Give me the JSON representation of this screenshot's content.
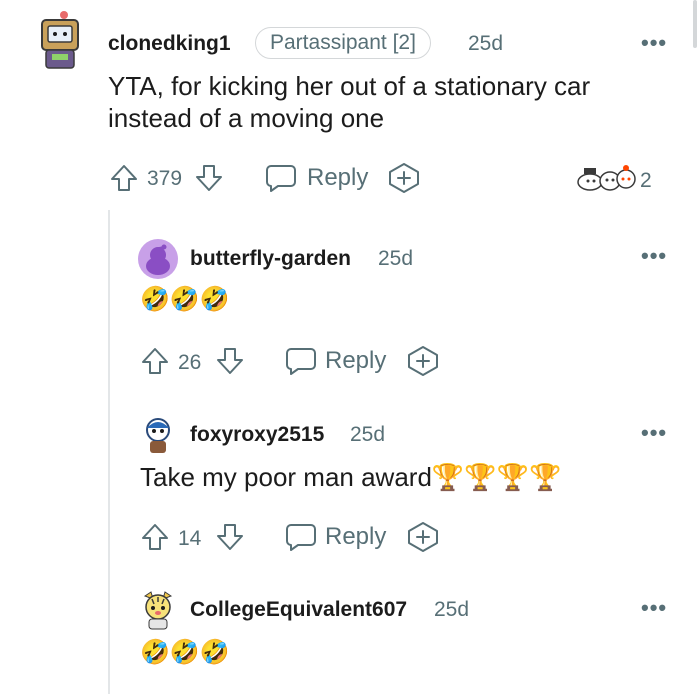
{
  "comments": [
    {
      "username": "clonedking1",
      "flair": "Partassipant [2]",
      "time": "25d",
      "body": "YTA, for kicking her out of a stationary car instead of a moving one",
      "votes": "379",
      "reply_label": "Reply",
      "awards_count": "2",
      "avatar_icon": "robot-box-avatar-icon"
    },
    {
      "username": "butterfly-garden",
      "time": "25d",
      "body": "🤣🤣🤣",
      "votes": "26",
      "reply_label": "Reply",
      "avatar_icon": "default-snoo-avatar-icon"
    },
    {
      "username": "foxyroxy2515",
      "time": "25d",
      "body": "Take my poor man award🏆🏆🏆🏆",
      "votes": "14",
      "reply_label": "Reply",
      "avatar_icon": "snoo-avatar-icon"
    },
    {
      "username": "CollegeEquivalent607",
      "time": "25d",
      "body": "🤣🤣🤣",
      "avatar_icon": "tiger-avatar-icon"
    }
  ],
  "more_label": "•••",
  "colors": {
    "text": "#1c1c1c",
    "meta": "#576f76",
    "thread_line": "#e3e6e8",
    "avatar_purple": "#c8a0e8"
  }
}
